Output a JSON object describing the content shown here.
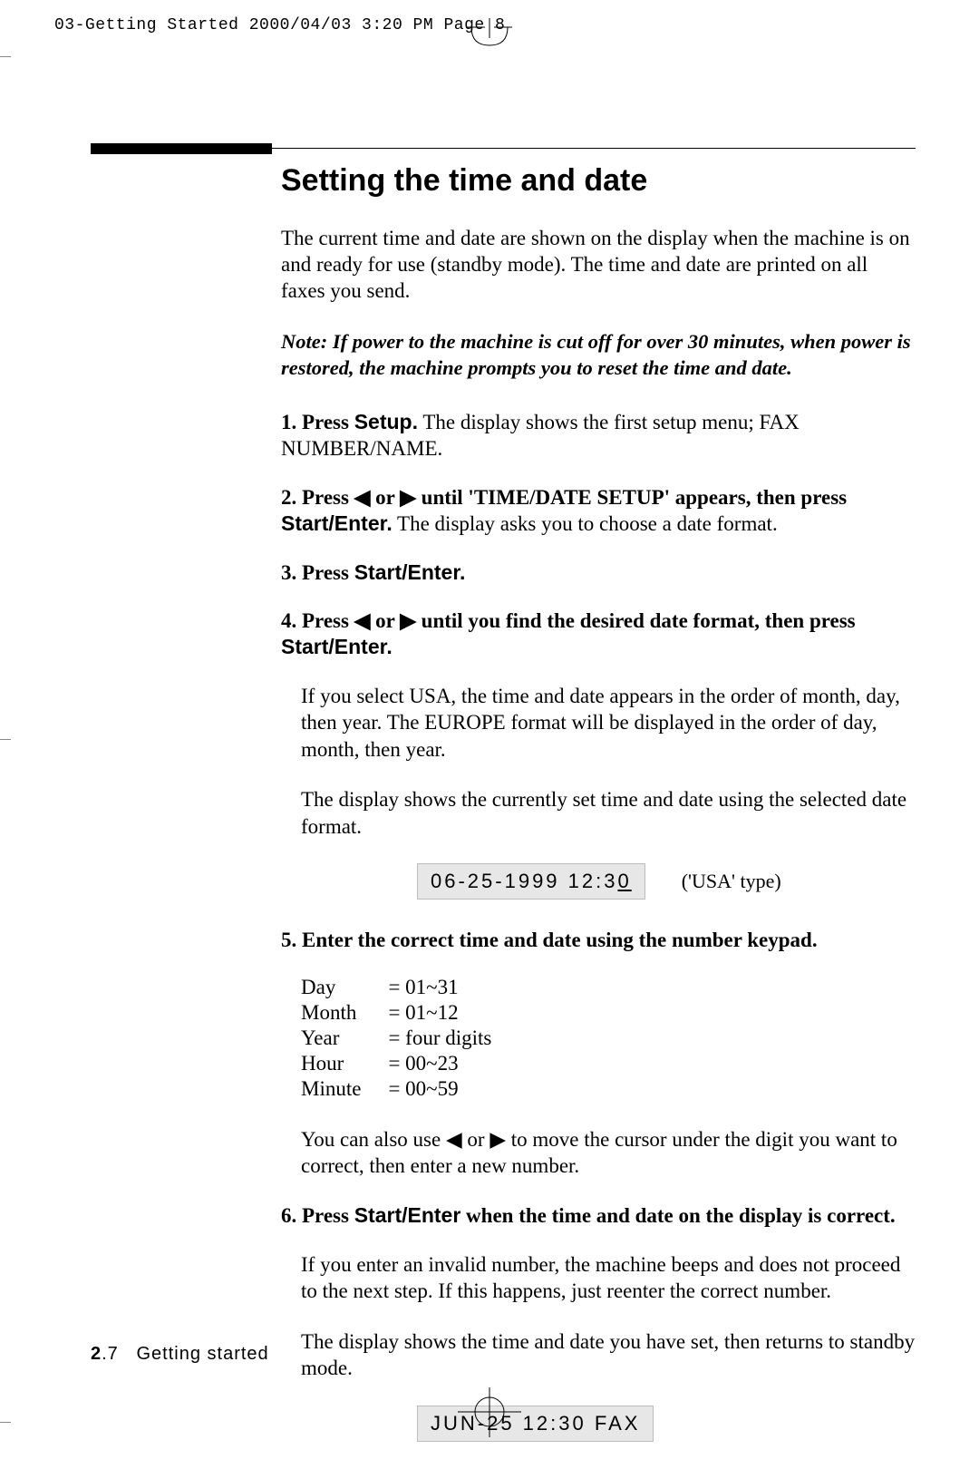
{
  "slug": "03-Getting Started  2000/04/03 3:20 PM  Page 8",
  "title": "Setting the time and date",
  "intro": "The current time and date are shown on the display when the machine is on and ready for use (standby mode). The time and date are printed on all faxes you send.",
  "note": "Note: If power to the machine is cut off for over 30 minutes, when power is restored, the machine prompts you to reset the time and date.",
  "step1_lead": "1. Press ",
  "step1_btn": "Setup.",
  "step1_tail": " The display shows the first setup menu; FAX NUMBER/NAME.",
  "step2_lead": "2. Press ",
  "step2_mid": " or ",
  "step2_bold2": " until 'TIME/DATE SETUP' appears, then press ",
  "step2_btn": "Start/Enter.",
  "step2_tail": " The display asks you to choose a date format.",
  "step3_lead": "3. Press ",
  "step3_btn": "Start/Enter.",
  "step4_lead": "4. Press ",
  "step4_mid": " or ",
  "step4_bold2": " until you find the desired date format, then press ",
  "step4_btn": "Start/Enter.",
  "formats_para": "If you select USA, the time and date appears in the order of month, day, then year. The EUROPE format will be displayed in the order of day, month, then year.",
  "shows_para": "The display shows the currently set time and date using the selected date format.",
  "lcd1_a": "06-25-1999 12:3",
  "lcd1_b": "0",
  "lcd1_note": "('USA' type)",
  "step5": "5. Enter the correct time and date using the number keypad.",
  "ranges": [
    {
      "k": "Day",
      "v": "= 01~31"
    },
    {
      "k": "Month",
      "v": "= 01~12"
    },
    {
      "k": "Year",
      "v": "= four digits"
    },
    {
      "k": "Hour",
      "v": "= 00~23"
    },
    {
      "k": "Minute",
      "v": "= 00~59"
    }
  ],
  "cursor_para_a": "You can also use ",
  "cursor_para_mid": " or ",
  "cursor_para_b": " to move the cursor under the digit you want to correct, then enter a new number.",
  "step6_lead": "6. Press ",
  "step6_btn": "Start/Enter",
  "step6_tail": " when the time and date on the display is correct.",
  "invalid_para": "If you enter an invalid number, the machine beeps and does not proceed to the next step. If this happens, just reenter the correct number.",
  "return_para": "The display shows the time and date you have set, then returns to standby mode.",
  "lcd2": "JUN-25 12:30 FAX",
  "footer_pg": "2",
  "footer_sub": ".7",
  "footer_txt": "Getting started",
  "arrow_left": "◀",
  "arrow_right": "▶"
}
